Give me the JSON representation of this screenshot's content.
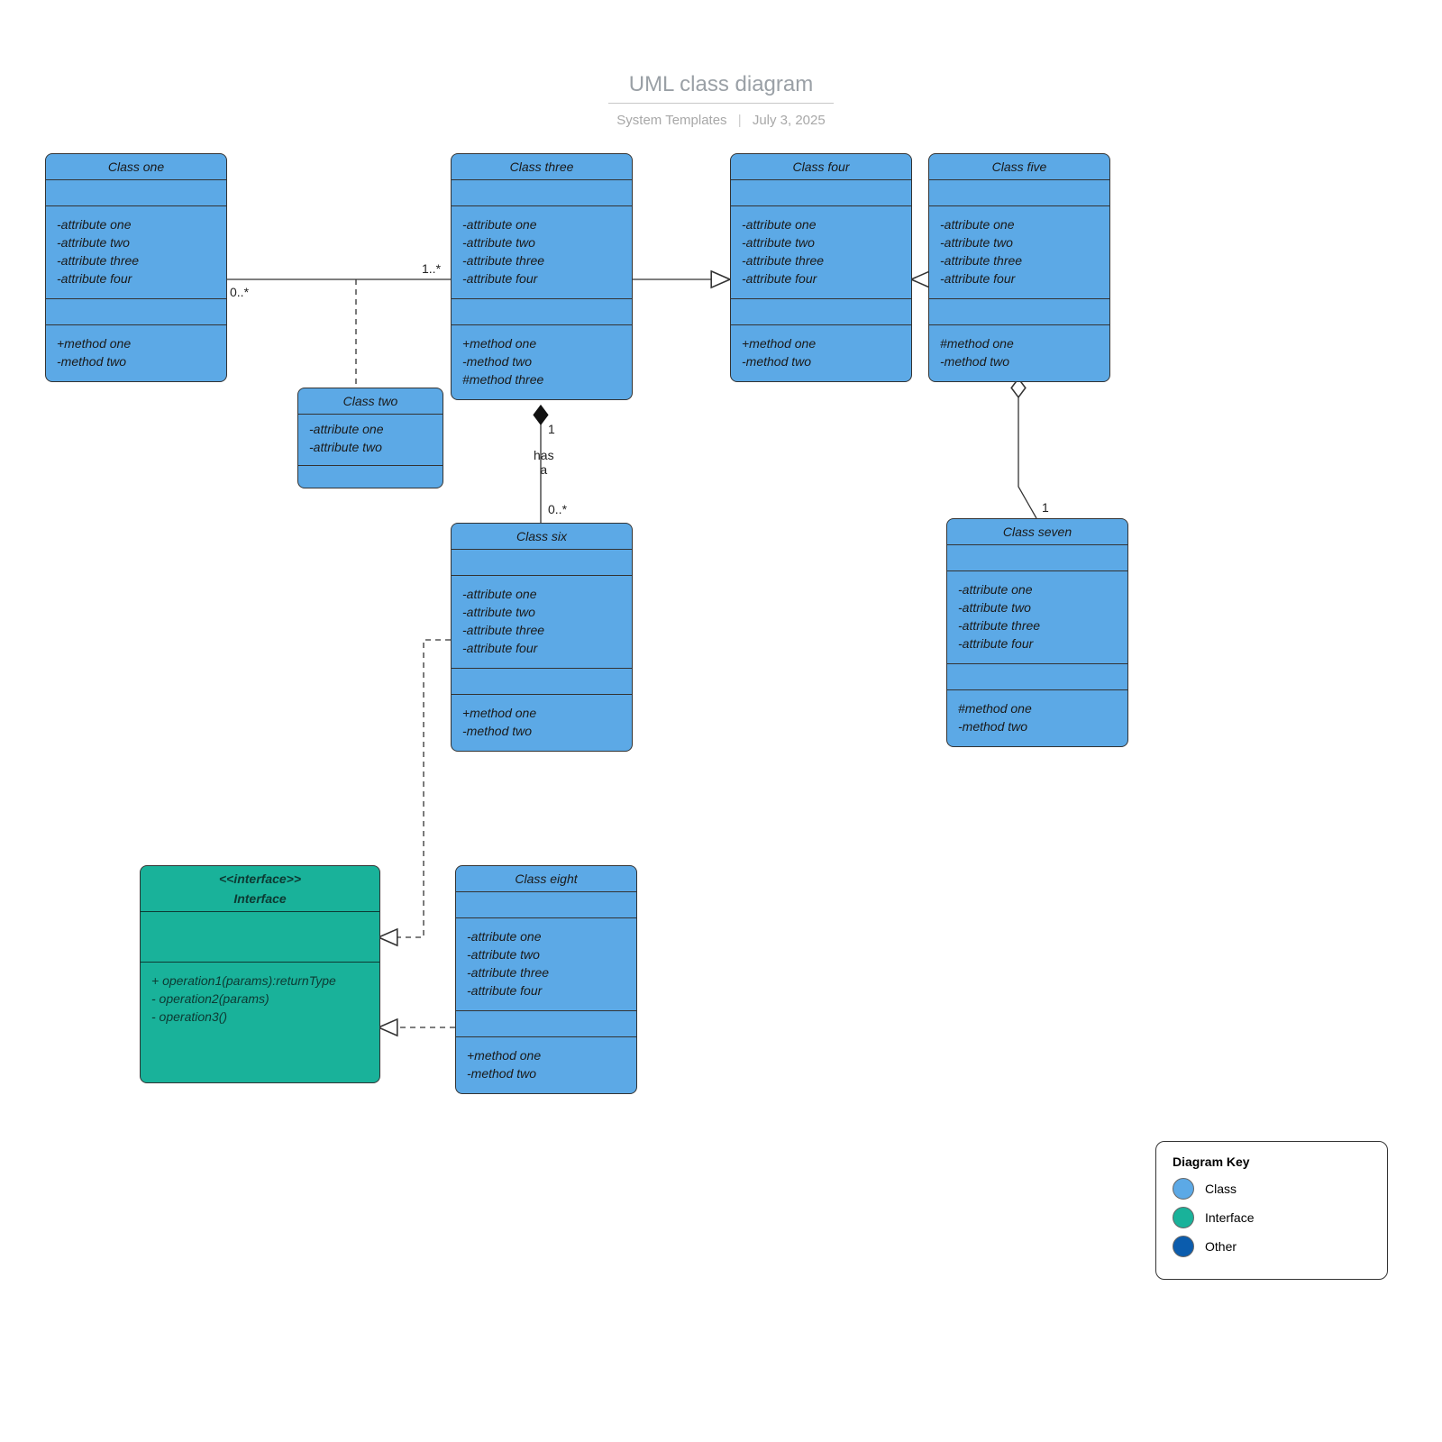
{
  "header": {
    "title": "UML class diagram",
    "author": "System Templates",
    "date": "July 3, 2025"
  },
  "colors": {
    "class": "#5ca9e6",
    "interface": "#19b29a",
    "other": "#0b5cad"
  },
  "legend": {
    "title": "Diagram Key",
    "items": [
      "Class",
      "Interface",
      "Other"
    ]
  },
  "classes": {
    "one": {
      "name": "Class one",
      "attrs": [
        "-attribute one",
        "-attribute two",
        "-attribute  three",
        "-attribute four"
      ],
      "methods": [
        "+method one",
        "-method two"
      ]
    },
    "two": {
      "name": "Class two",
      "attrs": [
        "-attribute one",
        "-attribute two"
      ],
      "methods": []
    },
    "three": {
      "name": "Class three",
      "attrs": [
        "-attribute one",
        "-attribute two",
        "-attribute  three",
        "-attribute four"
      ],
      "methods": [
        "+method one",
        "-method two",
        "#method three"
      ]
    },
    "four": {
      "name": "Class four",
      "attrs": [
        "-attribute one",
        "-attribute two",
        "-attribute  three",
        "-attribute four"
      ],
      "methods": [
        "+method one",
        "-method two"
      ]
    },
    "five": {
      "name": "Class five",
      "attrs": [
        "-attribute one",
        "-attribute two",
        "-attribute three",
        "-attribute four"
      ],
      "methods": [
        "#method one",
        "-method two"
      ]
    },
    "six": {
      "name": "Class six",
      "attrs": [
        "-attribute one",
        "-attribute two",
        "-attribute  three",
        "-attribute four"
      ],
      "methods": [
        "+method one",
        "-method two"
      ]
    },
    "seven": {
      "name": "Class seven",
      "attrs": [
        "-attribute one",
        "-attribute two",
        "-attribute three",
        "-attribute four"
      ],
      "methods": [
        "#method one",
        "-method two"
      ]
    },
    "eight": {
      "name": "Class eight",
      "attrs": [
        "-attribute one",
        "-attribute two",
        "-attribute  three",
        "-attribute four"
      ],
      "methods": [
        "+method one",
        "-method two"
      ]
    }
  },
  "interface": {
    "stereotype": "<<interface>>",
    "name": "Interface",
    "ops": [
      "+ operation1(params):returnType",
      "- operation2(params)",
      "- operation3()"
    ]
  },
  "relations": {
    "one_three_left": "0..*",
    "one_three_right": "1..*",
    "three_six_top": "1",
    "three_six_label": "has\na",
    "three_six_bottom": "0..*",
    "five_seven": "1"
  }
}
